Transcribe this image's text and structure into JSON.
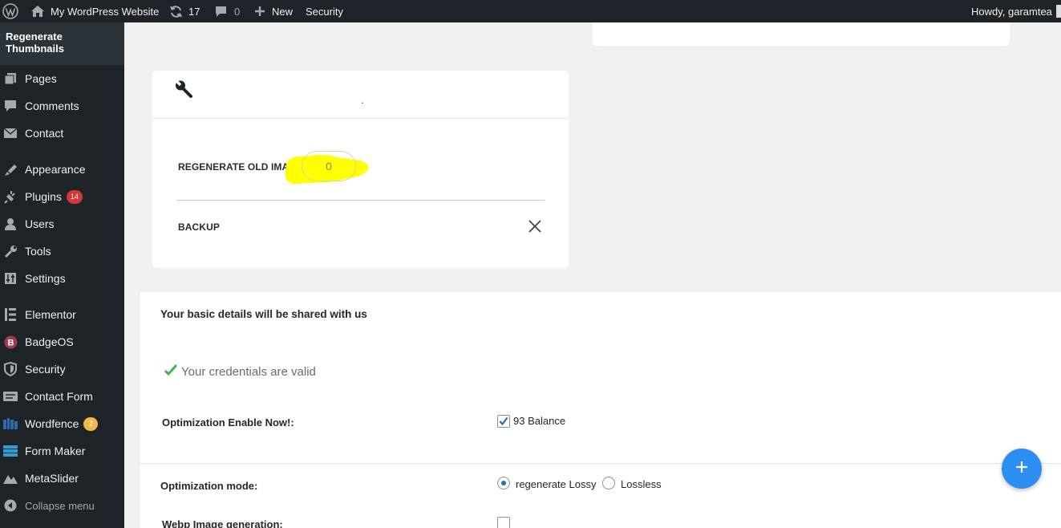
{
  "adminbar": {
    "site_name": "My WordPress Website",
    "updates_count": "17",
    "comments_count": "0",
    "new_label": "New",
    "security_label": "Security",
    "howdy": "Howdy, garamtea"
  },
  "sidebar": {
    "current_page": "Regenerate Thumbnails",
    "items": [
      {
        "label": "Pages",
        "icon": "pages-icon"
      },
      {
        "label": "Comments",
        "icon": "comments-icon"
      },
      {
        "label": "Contact",
        "icon": "contact-icon"
      },
      {
        "label": "Appearance",
        "icon": "appearance-icon"
      },
      {
        "label": "Plugins",
        "icon": "plugins-icon",
        "badge": "14"
      },
      {
        "label": "Users",
        "icon": "users-icon"
      },
      {
        "label": "Tools",
        "icon": "tools-icon"
      },
      {
        "label": "Settings",
        "icon": "settings-icon"
      },
      {
        "label": "Elementor",
        "icon": "elementor-icon"
      },
      {
        "label": "BadgeOS",
        "icon": "badgeos-icon"
      },
      {
        "label": "Security",
        "icon": "security-icon"
      },
      {
        "label": "Contact Form",
        "icon": "contact-form-icon"
      },
      {
        "label": "Wordfence",
        "icon": "wordfence-icon",
        "badge": "2"
      },
      {
        "label": "Form Maker",
        "icon": "form-maker-icon"
      },
      {
        "label": "MetaSlider",
        "icon": "metaslider-icon"
      },
      {
        "label": "Collapse menu",
        "icon": "collapse-icon"
      }
    ],
    "badge_colors": {
      "plugins": "#d63638",
      "wordfence": "#f0b849"
    }
  },
  "tools_card": {
    "header_icon": "wrench-icon",
    "header_dot": ".",
    "regenerate_label": "REGENERATE OLD IMAGES",
    "regenerate_value": "0",
    "backup_label": "BACKUP",
    "backup_icon": "close-icon"
  },
  "details_panel": {
    "title": "Your basic details will be shared with us",
    "credentials_text": "Your credentials are valid",
    "optimization_enable_label": "Optimization Enable Now!:",
    "balance_text": "93 Balance",
    "balance_checked": true,
    "optimization_mode_label": "Optimization mode:",
    "mode_options": [
      {
        "label": "regenerate Lossy",
        "selected": true
      },
      {
        "label": "Lossless",
        "selected": false
      }
    ],
    "webp_label": "Webp Image generation:",
    "webp_checked": false
  },
  "colors": {
    "admin_dark": "#1d2327",
    "highlight": "#ffff00",
    "check_green": "#46b450",
    "fab_blue": "#2c8ef0"
  }
}
